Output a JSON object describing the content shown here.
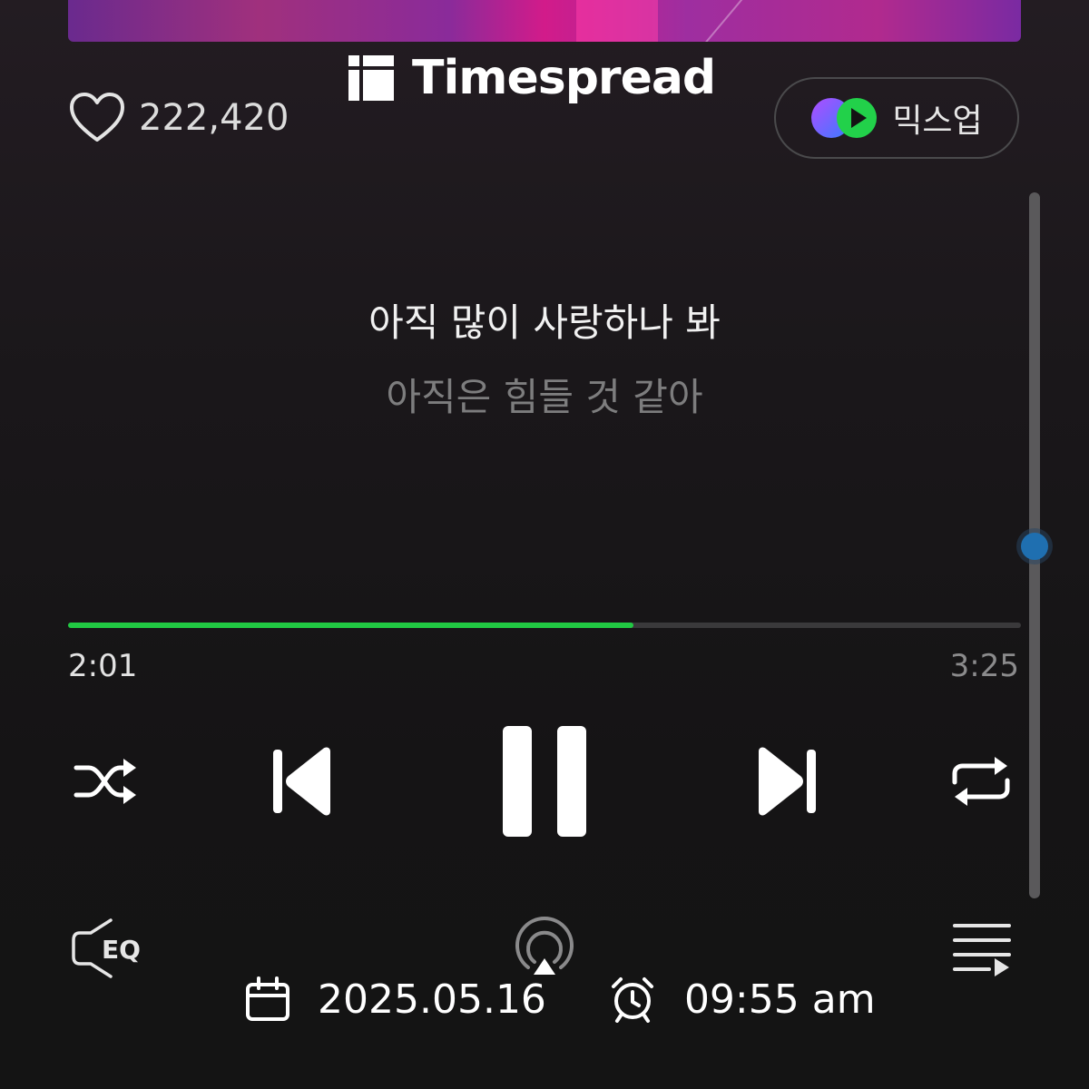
{
  "brand": {
    "name": "Timespread"
  },
  "header": {
    "like_count": "222,420",
    "mixup_label": "믹스업"
  },
  "lyrics": {
    "current": "아직 많이 사랑하나 봐",
    "next": "아직은 힘들 것 같아"
  },
  "playback": {
    "elapsed": "2:01",
    "total": "3:25",
    "progress_fraction": 0.593,
    "accent_color": "#21c943"
  },
  "controls": {
    "icons": [
      "shuffle-icon",
      "previous-icon",
      "pause-icon",
      "next-icon",
      "repeat-icon"
    ]
  },
  "bottom_bar": {
    "eq_label": "EQ",
    "icons": [
      "eq-icon",
      "airplay-icon",
      "playlist-icon"
    ]
  },
  "footer": {
    "date": "2025.05.16",
    "time": "09:55 am"
  }
}
